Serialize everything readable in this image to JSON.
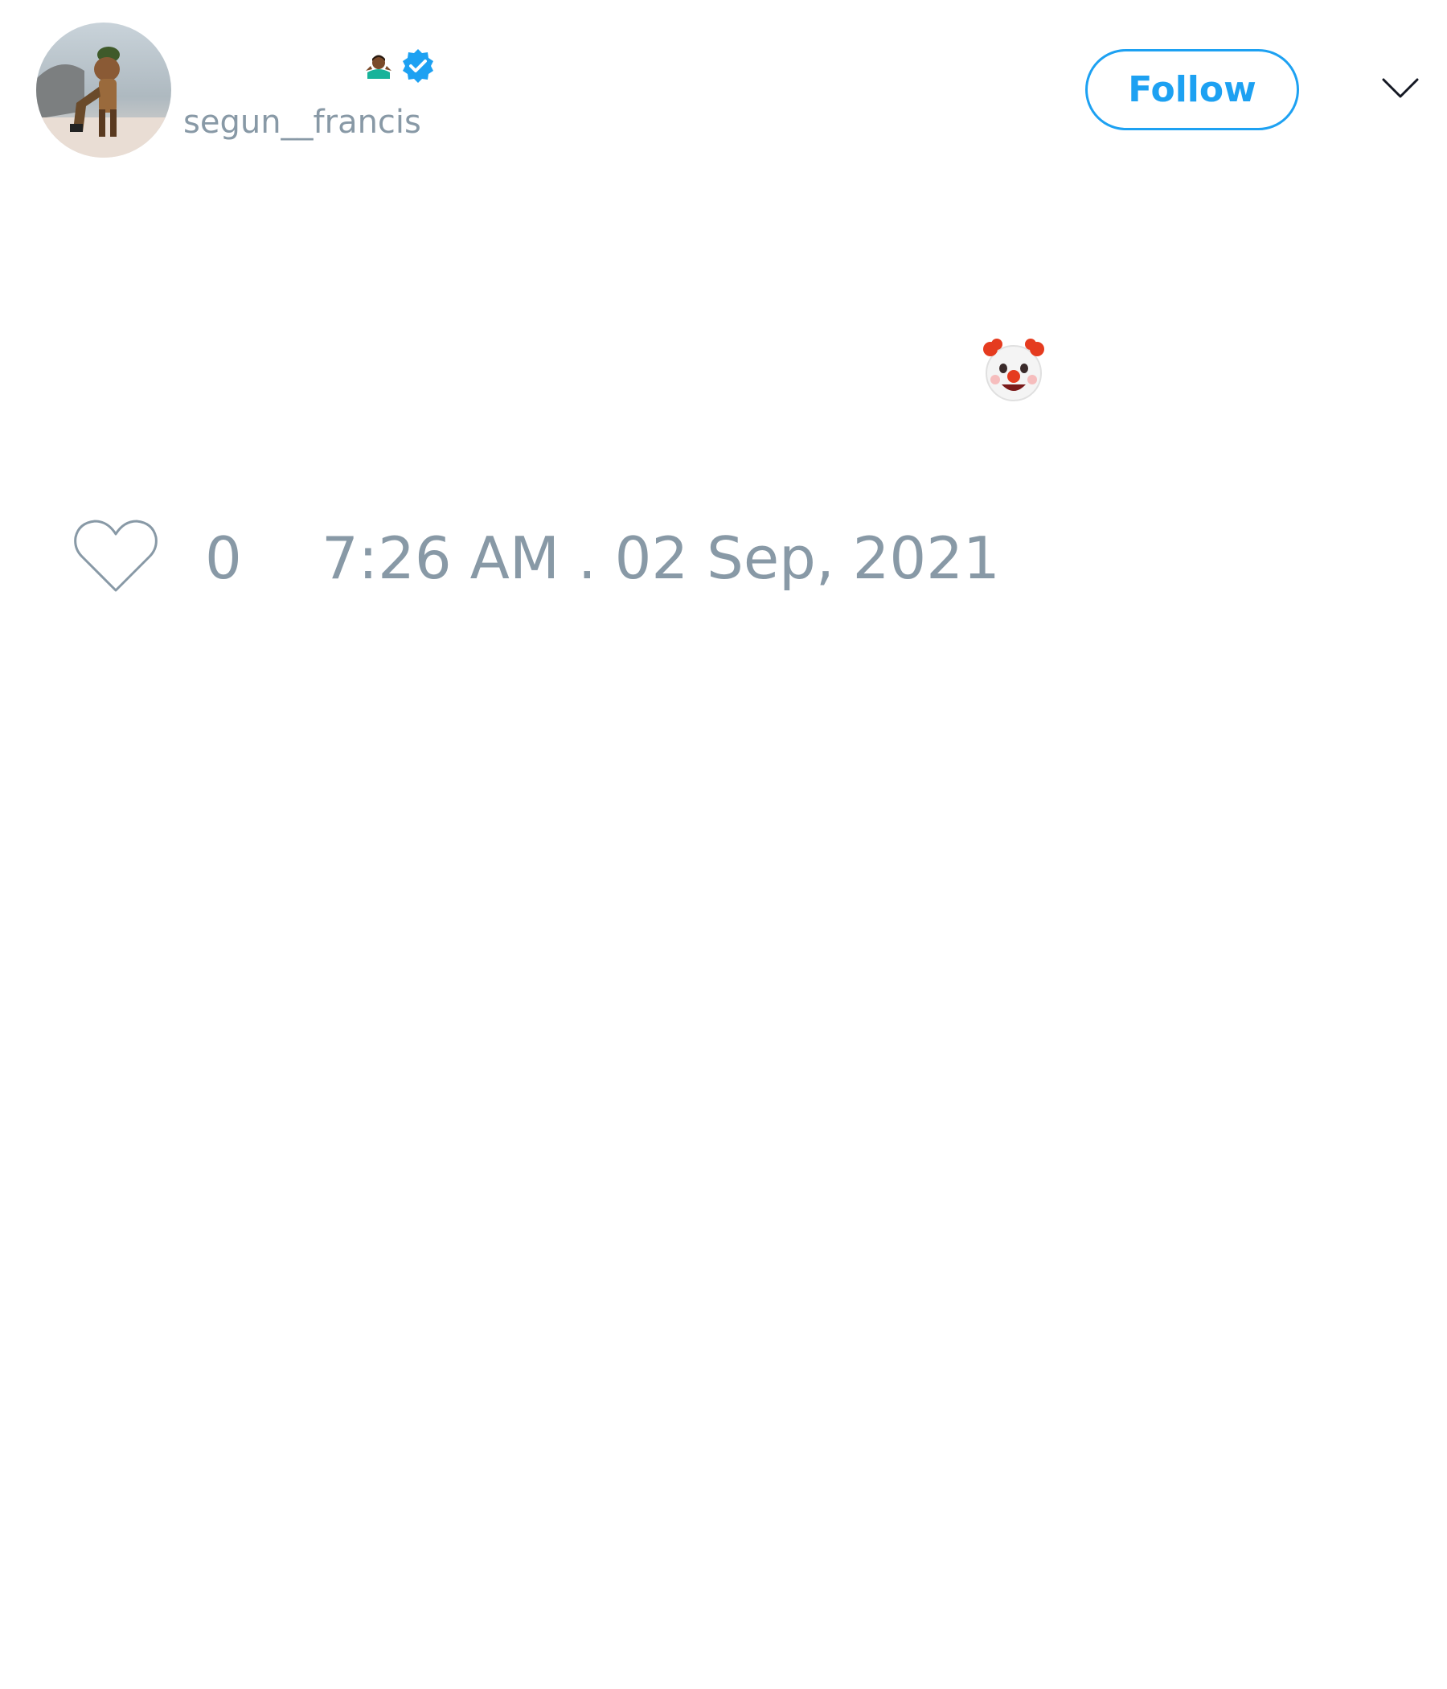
{
  "header": {
    "avatar": {
      "icon": "profile-photo"
    },
    "display_name": "",
    "name_emoji": "man-shrugging-emoji",
    "verified_icon": "verified-badge-icon",
    "handle": "segun__francis",
    "follow_label": "Follow",
    "menu_icon": "chevron-down-icon"
  },
  "tweet": {
    "text": "",
    "emoji": "clown-face-emoji"
  },
  "footer": {
    "like_icon": "heart-icon",
    "like_count": "0",
    "timestamp": "7:26 AM . 02 Sep, 2021"
  },
  "colors": {
    "accent": "#1da1f2",
    "muted_text": "#8899a6",
    "primary_text": "#141823",
    "background": "#ffffff"
  }
}
